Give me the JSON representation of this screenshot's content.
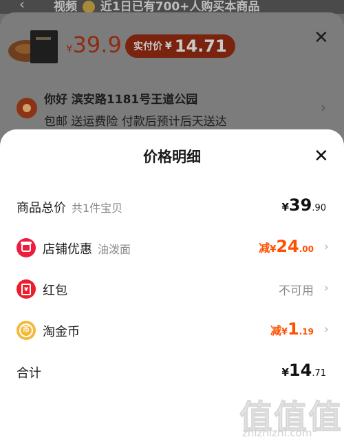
{
  "background": {
    "top_banner": {
      "text_left": "视频",
      "text_right": "近1日已有700+人购买本商品"
    },
    "product": {
      "currency": "¥",
      "price": "39.9",
      "paid_label": "实付价",
      "paid_currency": "¥",
      "paid_price": "14.71"
    },
    "address": {
      "line1": "你好 滨安路1181号王道公园",
      "line2": "包邮 送运费险 付款后预计后天送达"
    }
  },
  "modal": {
    "title": "价格明细",
    "rows": [
      {
        "label": "商品总价",
        "sub": "共1件宝贝",
        "currency": "¥",
        "int": "39",
        "dec": ".90"
      },
      {
        "label": "店铺优惠",
        "sub": "油泼面",
        "prefix": "减",
        "currency": "¥",
        "int": "24",
        "dec": ".00",
        "icon": "shop-icon"
      },
      {
        "label": "红包",
        "status": "不可用",
        "icon": "red-packet-icon",
        "icon_glyph": "¥"
      },
      {
        "label": "淘金币",
        "prefix": "减",
        "currency": "¥",
        "int": "1",
        "dec": ".19",
        "icon": "coin-icon",
        "icon_glyph": "币"
      },
      {
        "label": "合计",
        "currency": "¥",
        "int": "14",
        "dec": ".71"
      }
    ]
  },
  "watermark": {
    "chars": "值值值",
    "url": "zhizhizhi.com"
  },
  "colors": {
    "accent": "#ff5000",
    "overlay": "#7c7c7c",
    "modal_bg": "#ffffff"
  }
}
